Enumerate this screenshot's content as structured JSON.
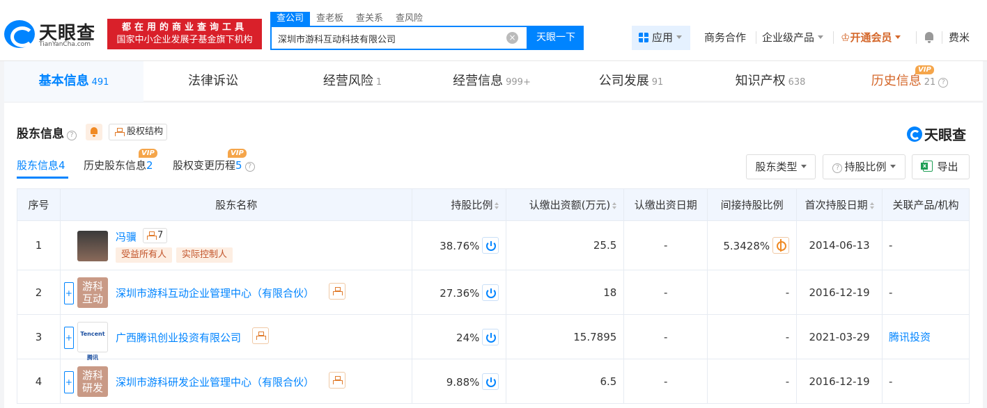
{
  "brand": {
    "name": "天眼查",
    "domain": "TianYanCha.com"
  },
  "slogan": {
    "line1": "都在用的商业查询工具",
    "line2": "国家中小企业发展子基金旗下机构"
  },
  "search": {
    "tabs": [
      "查公司",
      "查老板",
      "查关系",
      "查风险"
    ],
    "value": "深圳市游科互动科技有限公司",
    "button": "天眼一下"
  },
  "nav": {
    "apps": "应用",
    "business": "商务合作",
    "enterprise": "企业级产品",
    "vip": "开通会员",
    "user": "费米"
  },
  "main_tabs": [
    {
      "label": "基本信息",
      "count": "491"
    },
    {
      "label": "法律诉讼",
      "count": ""
    },
    {
      "label": "经营风险",
      "count": "1"
    },
    {
      "label": "经营信息",
      "count": "999+"
    },
    {
      "label": "公司发展",
      "count": "91"
    },
    {
      "label": "知识产权",
      "count": "638"
    },
    {
      "label": "历史信息",
      "count": "21"
    }
  ],
  "vip_badge": "VIP",
  "section": {
    "title": "股东信息",
    "structure_btn": "股权结构"
  },
  "sub_tabs": [
    {
      "label": "股东信息",
      "count": "4"
    },
    {
      "label": "历史股东信息",
      "count": "2"
    },
    {
      "label": "股权变更历程",
      "count": "5"
    }
  ],
  "filters": {
    "type": "股东类型",
    "ratio": "持股比例",
    "export": "导出"
  },
  "table": {
    "headers": [
      "序号",
      "股东名称",
      "持股比例",
      "认缴出资额(万元)",
      "认缴出资日期",
      "间接持股比例",
      "首次持股日期",
      "关联产品/机构"
    ],
    "rows": [
      {
        "idx": "1",
        "name": "冯骥",
        "relations": "7",
        "tags": [
          "受益所有人",
          "实际控制人"
        ],
        "ratio": "38.76%",
        "capital": "25.5",
        "date": "-",
        "indirect": "5.3428%",
        "first": "2014-06-13",
        "related": "-"
      },
      {
        "idx": "2",
        "avatar": "游科互动",
        "name": "深圳市游科互动企业管理中心（有限合伙）",
        "ratio": "27.36%",
        "capital": "18",
        "date": "-",
        "indirect": "-",
        "first": "2016-12-19",
        "related": "-"
      },
      {
        "idx": "3",
        "avatar": "Tencent 腾讯",
        "name": "广西腾讯创业投资有限公司",
        "ratio": "24%",
        "capital": "15.7895",
        "date": "-",
        "indirect": "-",
        "first": "2021-03-29",
        "related": "腾讯投资"
      },
      {
        "idx": "4",
        "avatar": "游科研发",
        "name": "深圳市游科研发企业管理中心（有限合伙）",
        "ratio": "9.88%",
        "capital": "6.5",
        "date": "-",
        "indirect": "-",
        "first": "2016-12-19",
        "related": "-"
      }
    ]
  },
  "colors": {
    "primary": "#0084ff",
    "vip": "#d4672a",
    "slogan_bg": "#d9202a"
  }
}
